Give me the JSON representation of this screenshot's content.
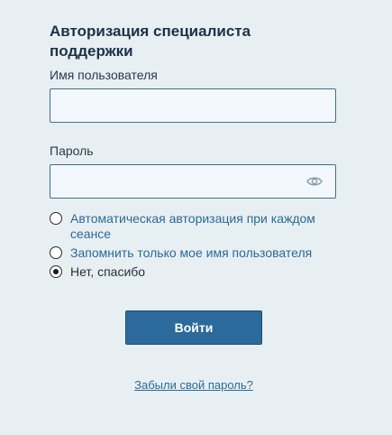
{
  "form": {
    "title": "Авторизация специалиста поддержки",
    "username": {
      "label": "Имя пользователя",
      "value": "",
      "placeholder": ""
    },
    "password": {
      "label": "Пароль",
      "value": "",
      "placeholder": "",
      "toggle_icon": "eye-icon"
    },
    "remember_options": [
      {
        "label": "Автоматическая авторизация при каждом сеансе",
        "selected": false
      },
      {
        "label": "Запомнить только мое имя пользователя",
        "selected": false
      },
      {
        "label": "Нет, спасибо",
        "selected": true
      }
    ],
    "submit_label": "Войти",
    "forgot_link": "Забыли свой пароль?"
  },
  "colors": {
    "background": "#e8eff3",
    "accent": "#2b6a9a",
    "link": "#2b6a96",
    "field_bg": "#f2f8fd"
  }
}
